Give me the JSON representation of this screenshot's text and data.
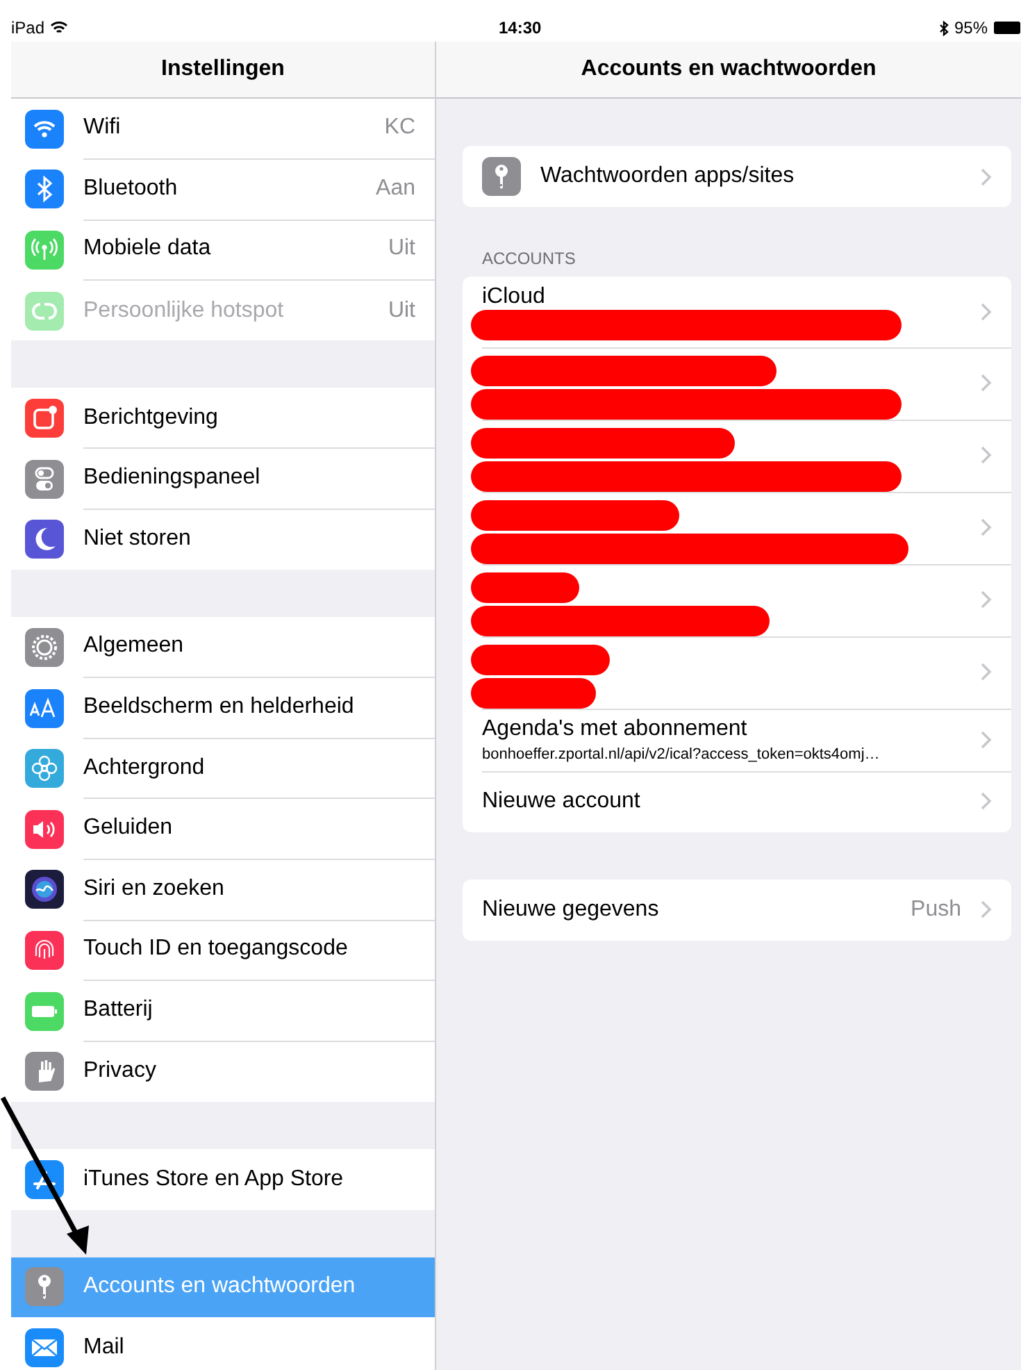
{
  "status_bar": {
    "device": "iPad",
    "time": "14:30",
    "battery": "95%"
  },
  "sidebar": {
    "title": "Instellingen",
    "groups": [
      [
        {
          "label": "Wifi",
          "value": "KC",
          "disabled": false,
          "selected": false
        },
        {
          "label": "Bluetooth",
          "value": "Aan",
          "disabled": false,
          "selected": false
        },
        {
          "label": "Mobiele data",
          "value": "Uit",
          "disabled": false,
          "selected": false
        },
        {
          "label": "Persoonlijke hotspot",
          "value": "Uit",
          "disabled": true,
          "selected": false
        }
      ],
      [
        {
          "label": "Berichtgeving",
          "disabled": false,
          "selected": false
        },
        {
          "label": "Bedieningspaneel",
          "disabled": false,
          "selected": false
        },
        {
          "label": "Niet storen",
          "disabled": false,
          "selected": false
        }
      ],
      [
        {
          "label": "Algemeen",
          "disabled": false,
          "selected": false
        },
        {
          "label": "Beeldscherm en helderheid",
          "disabled": false,
          "selected": false
        },
        {
          "label": "Achtergrond",
          "disabled": false,
          "selected": false
        },
        {
          "label": "Geluiden",
          "disabled": false,
          "selected": false
        },
        {
          "label": "Siri en zoeken",
          "disabled": false,
          "selected": false
        },
        {
          "label": "Touch ID en toegangscode",
          "disabled": false,
          "selected": false
        },
        {
          "label": "Batterij",
          "disabled": false,
          "selected": false
        },
        {
          "label": "Privacy",
          "disabled": false,
          "selected": false
        }
      ],
      [
        {
          "label": "iTunes Store en App Store",
          "disabled": false,
          "selected": false
        }
      ],
      [
        {
          "label": "Accounts en wachtwoorden",
          "disabled": false,
          "selected": true
        },
        {
          "label": "Mail",
          "disabled": false,
          "selected": false
        }
      ]
    ]
  },
  "detail": {
    "title": "Accounts en wachtwoorden",
    "sections": [
      {
        "rows": [
          {
            "label": "Wachtwoorden apps/sites",
            "icon": true,
            "redacted": false
          }
        ]
      },
      {
        "header": "ACCOUNTS",
        "rows": [
          {
            "label": "iCloud",
            "redacted": true
          },
          {
            "redacted": true
          },
          {
            "redacted": true
          },
          {
            "redacted": true
          },
          {
            "redacted": true
          },
          {
            "redacted": true
          },
          {
            "label": "Agenda's met abonnement",
            "subtitle": "bonhoeffer.zportal.nl/api/v2/ical?access_token=okts4omj…",
            "redacted": false
          },
          {
            "label": "Nieuwe account",
            "redacted": false
          }
        ]
      },
      {
        "rows": [
          {
            "label": "Nieuwe gegevens",
            "value": "Push",
            "redacted": false
          }
        ]
      }
    ]
  },
  "annotation": {
    "arrow": true
  }
}
